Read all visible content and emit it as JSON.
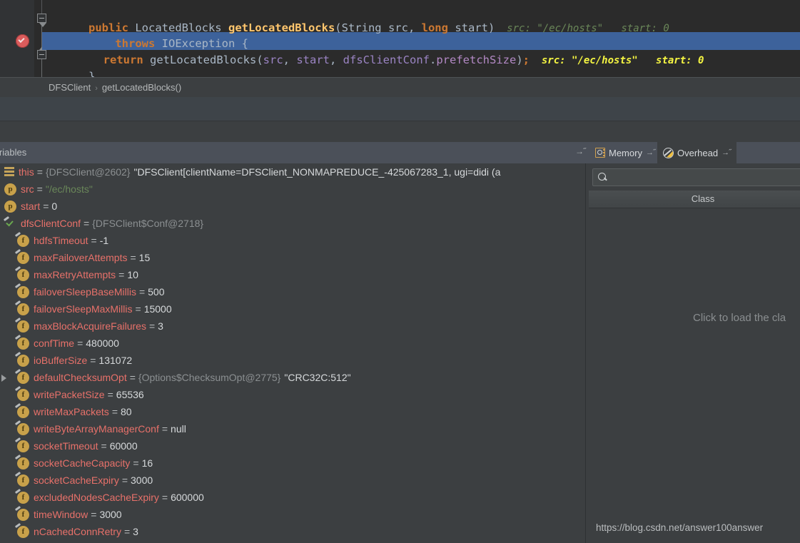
{
  "editor": {
    "lines": [
      {
        "id": "line-signature",
        "tokens": [
          {
            "t": "public ",
            "c": "kw"
          },
          {
            "t": "LocatedBlocks ",
            "c": "cls"
          },
          {
            "t": "getLocatedBlocks",
            "c": "mth"
          },
          {
            "t": "(",
            "c": "par"
          },
          {
            "t": "String ",
            "c": "cls"
          },
          {
            "t": "src",
            "c": "par"
          },
          {
            "t": ", ",
            "c": "par"
          },
          {
            "t": "long ",
            "c": "kw"
          },
          {
            "t": "start",
            "c": "par"
          },
          {
            "t": ")",
            "c": "par"
          }
        ],
        "hint": "src: \"/ec/hosts\"   start: 0"
      },
      {
        "id": "line-throws",
        "tokens": [
          {
            "t": "    throws ",
            "c": "kw"
          },
          {
            "t": "IOException",
            "c": "cls"
          },
          {
            "t": " {",
            "c": "par"
          }
        ],
        "hint": ""
      },
      {
        "id": "line-return",
        "tokens": [
          {
            "t": "  return ",
            "c": "kw"
          },
          {
            "t": "getLocatedBlocks",
            "c": "cls"
          },
          {
            "t": "(",
            "c": "par"
          },
          {
            "t": "src",
            "c": "prm"
          },
          {
            "t": ", ",
            "c": "par"
          },
          {
            "t": "start",
            "c": "prm"
          },
          {
            "t": ", ",
            "c": "par"
          },
          {
            "t": "dfsClientConf",
            "c": "prm"
          },
          {
            "t": ".",
            "c": "par"
          },
          {
            "t": "prefetchSize",
            "c": "pnk"
          },
          {
            "t": ")",
            "c": "par"
          },
          {
            "t": ";",
            "c": "kw"
          }
        ],
        "hint": "src: \"/ec/hosts\"   start: 0"
      },
      {
        "id": "line-close-brace",
        "tokens": [
          {
            "t": "}",
            "c": "par"
          }
        ],
        "hint": ""
      }
    ]
  },
  "breadcrumb": {
    "class": "DFSClient",
    "separator": "›",
    "method": "getLocatedBlocks()"
  },
  "debug_header": {
    "variables_tab": "Variables",
    "memory_tab": "Memory",
    "overhead_tab": "Overhead",
    "arrow_glyph": "→˝"
  },
  "variables": [
    {
      "icon": "this-icon",
      "indent": 0,
      "expander": false,
      "name": "this",
      "eq": "=",
      "ref": "{DFSClient@2602}",
      "value": "\"DFSClient[clientName=DFSClient_NONMAPREDUCE_-425067283_1, ugi=didi (a",
      "value_kind": "str-quoted"
    },
    {
      "icon": "parameter-icon",
      "indent": 0,
      "expander": false,
      "name": "src",
      "eq": "=",
      "ref": "",
      "value": "\"/ec/hosts\"",
      "value_kind": "string"
    },
    {
      "icon": "parameter-icon",
      "indent": 0,
      "expander": false,
      "name": "start",
      "eq": "=",
      "ref": "",
      "value": "0",
      "value_kind": "number"
    },
    {
      "icon": "field-check-icon",
      "indent": 0,
      "expander": false,
      "name": "dfsClientConf",
      "eq": "=",
      "ref": "{DFSClient$Conf@2718}",
      "value": "",
      "value_kind": "none"
    },
    {
      "icon": "field-icon",
      "indent": 1,
      "expander": false,
      "name": "hdfsTimeout",
      "eq": "=",
      "ref": "",
      "value": "-1",
      "value_kind": "number"
    },
    {
      "icon": "field-icon",
      "indent": 1,
      "expander": false,
      "name": "maxFailoverAttempts",
      "eq": "=",
      "ref": "",
      "value": "15",
      "value_kind": "number"
    },
    {
      "icon": "field-icon",
      "indent": 1,
      "expander": false,
      "name": "maxRetryAttempts",
      "eq": "=",
      "ref": "",
      "value": "10",
      "value_kind": "number"
    },
    {
      "icon": "field-icon",
      "indent": 1,
      "expander": false,
      "name": "failoverSleepBaseMillis",
      "eq": "=",
      "ref": "",
      "value": "500",
      "value_kind": "number"
    },
    {
      "icon": "field-icon",
      "indent": 1,
      "expander": false,
      "name": "failoverSleepMaxMillis",
      "eq": "=",
      "ref": "",
      "value": "15000",
      "value_kind": "number"
    },
    {
      "icon": "field-icon",
      "indent": 1,
      "expander": false,
      "name": "maxBlockAcquireFailures",
      "eq": "=",
      "ref": "",
      "value": "3",
      "value_kind": "number"
    },
    {
      "icon": "field-icon",
      "indent": 1,
      "expander": false,
      "name": "confTime",
      "eq": "=",
      "ref": "",
      "value": "480000",
      "value_kind": "number"
    },
    {
      "icon": "field-icon",
      "indent": 1,
      "expander": false,
      "name": "ioBufferSize",
      "eq": "=",
      "ref": "",
      "value": "131072",
      "value_kind": "number"
    },
    {
      "icon": "field-icon",
      "indent": 1,
      "expander": true,
      "name": "defaultChecksumOpt",
      "eq": "=",
      "ref": "{Options$ChecksumOpt@2775}",
      "value": "\"CRC32C:512\"",
      "value_kind": "str-quoted"
    },
    {
      "icon": "field-icon",
      "indent": 1,
      "expander": false,
      "name": "writePacketSize",
      "eq": "=",
      "ref": "",
      "value": "65536",
      "value_kind": "number"
    },
    {
      "icon": "field-icon",
      "indent": 1,
      "expander": false,
      "name": "writeMaxPackets",
      "eq": "=",
      "ref": "",
      "value": "80",
      "value_kind": "number"
    },
    {
      "icon": "field-icon",
      "indent": 1,
      "expander": false,
      "name": "writeByteArrayManagerConf",
      "eq": "=",
      "ref": "",
      "value": "null",
      "value_kind": "null"
    },
    {
      "icon": "field-icon",
      "indent": 1,
      "expander": false,
      "name": "socketTimeout",
      "eq": "=",
      "ref": "",
      "value": "60000",
      "value_kind": "number"
    },
    {
      "icon": "field-icon",
      "indent": 1,
      "expander": false,
      "name": "socketCacheCapacity",
      "eq": "=",
      "ref": "",
      "value": "16",
      "value_kind": "number"
    },
    {
      "icon": "field-icon",
      "indent": 1,
      "expander": false,
      "name": "socketCacheExpiry",
      "eq": "=",
      "ref": "",
      "value": "3000",
      "value_kind": "number"
    },
    {
      "icon": "field-icon",
      "indent": 1,
      "expander": false,
      "name": "excludedNodesCacheExpiry",
      "eq": "=",
      "ref": "",
      "value": "600000",
      "value_kind": "number"
    },
    {
      "icon": "field-icon",
      "indent": 1,
      "expander": false,
      "name": "timeWindow",
      "eq": "=",
      "ref": "",
      "value": "3000",
      "value_kind": "number"
    },
    {
      "icon": "field-icon",
      "indent": 1,
      "expander": false,
      "name": "nCachedConnRetry",
      "eq": "=",
      "ref": "",
      "value": "3",
      "value_kind": "number"
    }
  ],
  "memory_pane": {
    "search_placeholder": "",
    "column_header": "Class",
    "empty_message": "Click to load the cla",
    "watermark": "https://blog.csdn.net/answer100answer"
  },
  "colors": {
    "editor_bg": "#2b2b2b",
    "panel_bg": "#3c3f41",
    "selection": "#3d629b",
    "header_bg": "#4b5059",
    "keyword": "#cc7832",
    "method": "#ffc66d",
    "var_name": "#e8716a",
    "string": "#6a8759",
    "hint_selected": "#f5f542",
    "breakpoint": "#db5c5c"
  }
}
